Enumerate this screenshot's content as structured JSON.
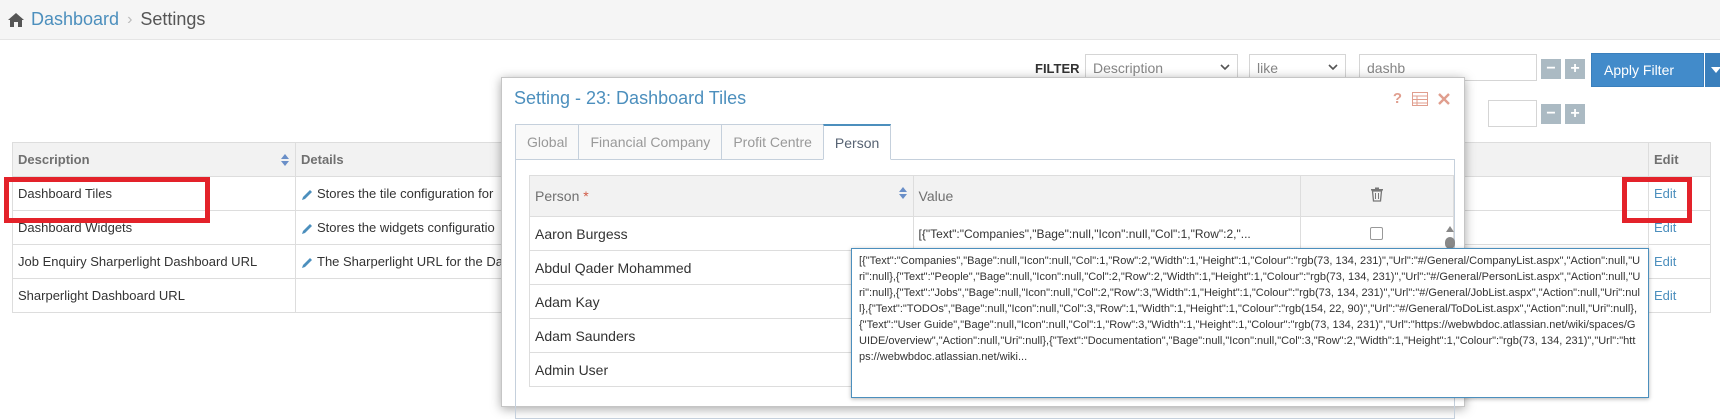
{
  "breadcrumb": {
    "home": "Dashboard",
    "current": "Settings"
  },
  "filter": {
    "label": "FILTER",
    "rows": [
      {
        "field": "Description",
        "operator": "like",
        "value": "dashb"
      },
      {
        "value": ""
      }
    ],
    "apply_label": "Apply Filter",
    "minus": "−",
    "plus": "+"
  },
  "main_table": {
    "columns": {
      "description": "Description",
      "details": "Details",
      "edit": "Edit"
    },
    "rows": [
      {
        "description": "Dashboard Tiles",
        "details": "Stores the tile configuration for",
        "edit": "Edit"
      },
      {
        "description": "Dashboard Widgets",
        "details": "Stores the widgets configuratio",
        "edit": "Edit"
      },
      {
        "description": "Job Enquiry Sharperlight Dashboard URL",
        "details": "The Sharperlight URL for the Da",
        "edit": "Edit"
      },
      {
        "description": "Sharperlight Dashboard URL",
        "details": "",
        "edit": "Edit"
      }
    ]
  },
  "modal": {
    "title": "Setting - 23: Dashboard Tiles",
    "help": "?",
    "tabs": [
      "Global",
      "Financial Company",
      "Profit Centre",
      "Person"
    ],
    "active_tab": "Person",
    "columns": {
      "person": "Person",
      "required_marker": "*",
      "value": "Value"
    },
    "rows": [
      {
        "person": "Aaron Burgess",
        "value": "[{\"Text\":\"Companies\",\"Bage\":null,\"Icon\":null,\"Col\":1,\"Row\":2,\"..."
      },
      {
        "person": "Abdul Qader Mohammed",
        "value": ""
      },
      {
        "person": "Adam Kay",
        "value": ""
      },
      {
        "person": "Adam Saunders",
        "value": ""
      },
      {
        "person": "Admin User",
        "value": ""
      }
    ]
  },
  "tooltip": {
    "text": "[{\"Text\":\"Companies\",\"Bage\":null,\"Icon\":null,\"Col\":1,\"Row\":2,\"Width\":1,\"Height\":1,\"Colour\":\"rgb(73, 134, 231)\",\"Url\":\"#/General/CompanyList.aspx\",\"Action\":null,\"Uri\":null},{\"Text\":\"People\",\"Bage\":null,\"Icon\":null,\"Col\":2,\"Row\":2,\"Width\":1,\"Height\":1,\"Colour\":\"rgb(73, 134, 231)\",\"Url\":\"#/General/PersonList.aspx\",\"Action\":null,\"Uri\":null},{\"Text\":\"Jobs\",\"Bage\":null,\"Icon\":null,\"Col\":2,\"Row\":3,\"Width\":1,\"Height\":1,\"Colour\":\"rgb(73, 134, 231)\",\"Url\":\"#/General/JobList.aspx\",\"Action\":null,\"Uri\":null},{\"Text\":\"TODOs\",\"Bage\":null,\"Icon\":null,\"Col\":3,\"Row\":1,\"Width\":1,\"Height\":1,\"Colour\":\"rgb(154, 22, 90)\",\"Url\":\"#/General/ToDoList.aspx\",\"Action\":null,\"Uri\":null},{\"Text\":\"User Guide\",\"Bage\":null,\"Icon\":null,\"Col\":1,\"Row\":3,\"Width\":1,\"Height\":1,\"Colour\":\"rgb(73, 134, 231)\",\"Url\":\"https://webwbdoc.atlassian.net/wiki/spaces/GUIDE/overview\",\"Action\":null,\"Uri\":null},{\"Text\":\"Documentation\",\"Bage\":null,\"Icon\":null,\"Col\":3,\"Row\":2,\"Width\":1,\"Height\":1,\"Colour\":\"rgb(73, 134, 231)\",\"Url\":\"https://webwbdoc.atlassian.net/wiki..."
  },
  "colors": {
    "accent": "#4c8fbd",
    "primary_button": "#428bca",
    "highlight": "#e3222a"
  }
}
